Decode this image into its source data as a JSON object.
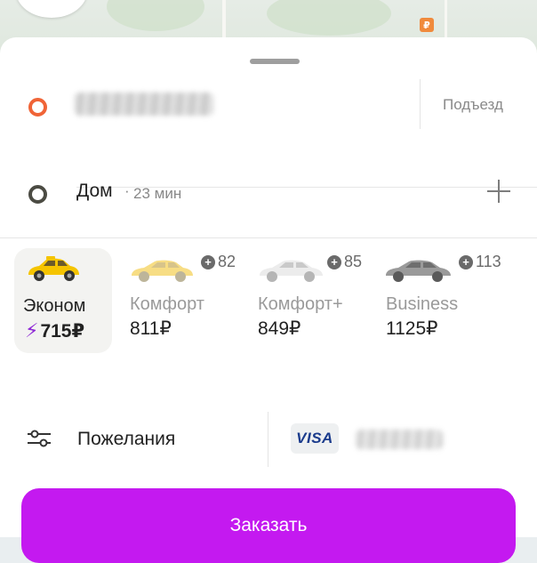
{
  "map": {
    "marker_symbol": "₽",
    "marker_color": "#f08a3c"
  },
  "route": {
    "from": {
      "entrance_label": "Подъезд",
      "dot_color": "#f06437"
    },
    "to": {
      "name": "Дом",
      "separator": "·",
      "eta": "23 мин",
      "dot_color": "#4b4b43",
      "add_icon": "plus-icon"
    }
  },
  "tariffs": [
    {
      "name": "Эконом",
      "price": "715₽",
      "selected": true,
      "boost_icon": "lightning-icon",
      "car_color": "#f5c400"
    },
    {
      "name": "Комфорт",
      "price": "811₽",
      "bonus": "82",
      "car_color": "#f7dd84"
    },
    {
      "name": "Комфорт+",
      "price": "849₽",
      "bonus": "85",
      "car_color": "#e8e8e8"
    },
    {
      "name": "Business",
      "price": "1125₽",
      "bonus": "113",
      "car_color": "#9a9a9a"
    }
  ],
  "options": {
    "wishes_label": "Пожелания",
    "wishes_icon": "sliders-icon"
  },
  "payment": {
    "card_brand": "VISA"
  },
  "order_button": {
    "label": "Заказать",
    "color": "#c419f0"
  }
}
